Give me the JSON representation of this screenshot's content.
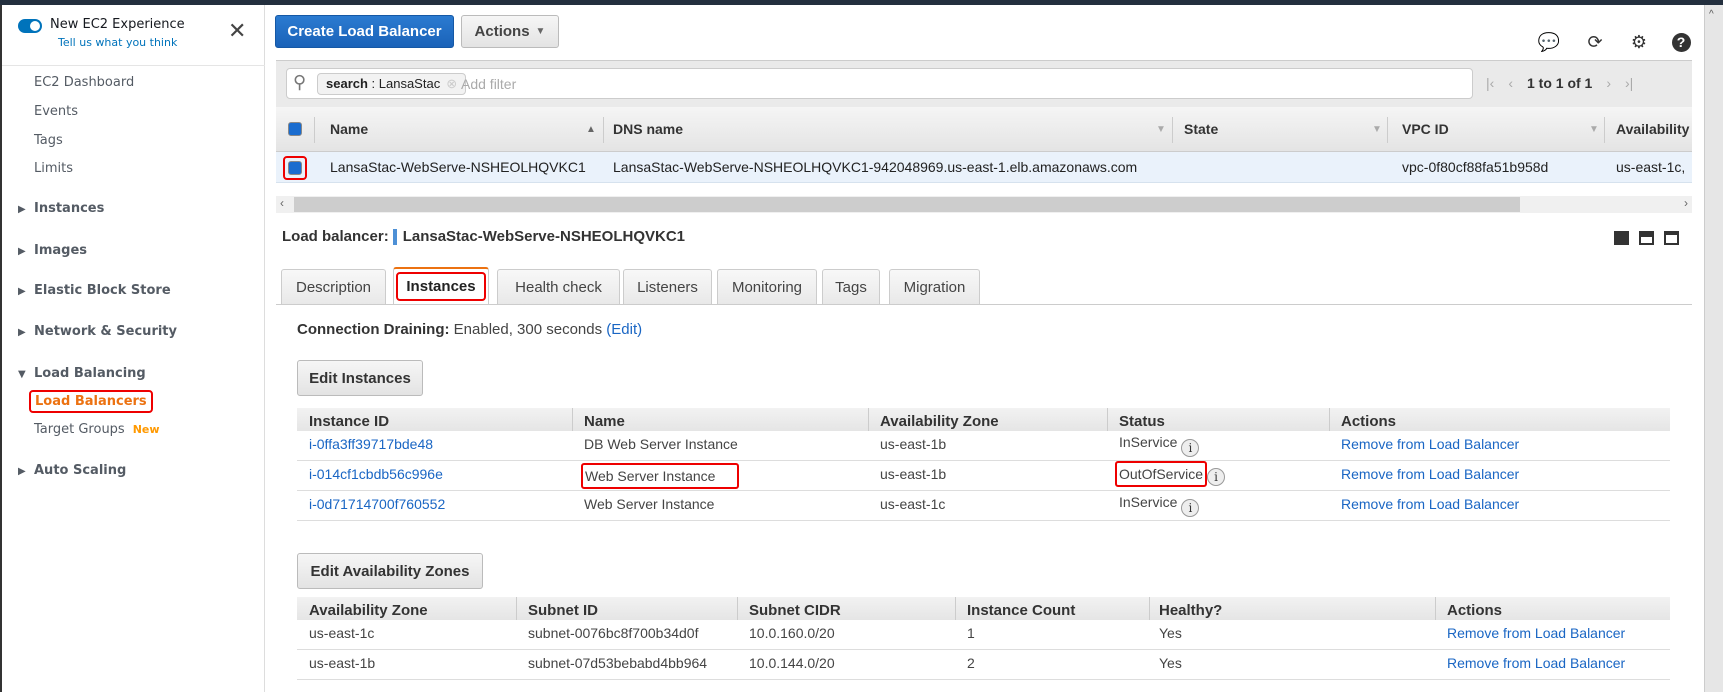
{
  "sidebar": {
    "experience_title": "New EC2 Experience",
    "feedback_link": "Tell us what you think",
    "items": [
      "EC2 Dashboard",
      "Events",
      "Tags",
      "Limits"
    ],
    "sections": [
      "Instances",
      "Images",
      "Elastic Block Store",
      "Network & Security",
      "Load Balancing",
      "Auto Scaling"
    ],
    "load_balancing_items": {
      "active": "Load Balancers",
      "target_groups": "Target Groups",
      "new_badge": "New"
    }
  },
  "toolbar": {
    "create_label": "Create Load Balancer",
    "actions_label": "Actions"
  },
  "filter": {
    "chip_key": "search",
    "chip_value": " : LansaStac",
    "placeholder": "Add filter",
    "pagination": "1 to 1 of 1"
  },
  "lb_table": {
    "headers": [
      "Name",
      "DNS name",
      "State",
      "VPC ID",
      "Availability"
    ],
    "row": {
      "name": "LansaStac-WebServe-NSHEOLHQVKC1",
      "dns": "LansaStac-WebServe-NSHEOLHQVKC1-942048969.us-east-1.elb.amazonaws.com",
      "state": "",
      "vpc": "vpc-0f80cf88fa51b958d",
      "az": "us-east-1c,"
    }
  },
  "details": {
    "label": "Load balancer:",
    "name": "LansaStac-WebServe-NSHEOLHQVKC1",
    "tabs": [
      "Description",
      "Instances",
      "Health check",
      "Listeners",
      "Monitoring",
      "Tags",
      "Migration"
    ],
    "connection_draining_label": "Connection Draining:",
    "connection_draining_value": "Enabled, 300 seconds",
    "edit_link": "(Edit)",
    "edit_instances": "Edit Instances",
    "instances_headers": [
      "Instance ID",
      "Name",
      "Availability Zone",
      "Status",
      "Actions"
    ],
    "instances": [
      {
        "id": "i-0ffa3ff39717bde48",
        "name": "DB Web Server Instance",
        "az": "us-east-1b",
        "status": "InService",
        "action": "Remove from Load Balancer"
      },
      {
        "id": "i-014cf1cbdb56c996e",
        "name": "Web Server Instance",
        "az": "us-east-1b",
        "status": "OutOfService",
        "action": "Remove from Load Balancer"
      },
      {
        "id": "i-0d71714700f760552",
        "name": "Web Server Instance",
        "az": "us-east-1c",
        "status": "InService",
        "action": "Remove from Load Balancer"
      }
    ],
    "edit_azs": "Edit Availability Zones",
    "az_headers": [
      "Availability Zone",
      "Subnet ID",
      "Subnet CIDR",
      "Instance Count",
      "Healthy?",
      "Actions"
    ],
    "azs": [
      {
        "zone": "us-east-1c",
        "subnet": "subnet-0076bc8f700b34d0f",
        "cidr": "10.0.160.0/20",
        "count": "1",
        "healthy": "Yes",
        "action": "Remove from Load Balancer"
      },
      {
        "zone": "us-east-1b",
        "subnet": "subnet-07d53bebabd4bb964",
        "cidr": "10.0.144.0/20",
        "count": "2",
        "healthy": "Yes",
        "action": "Remove from Load Balancer"
      }
    ]
  },
  "colors": {
    "primary": "#1a62b8",
    "link": "#1a66c4",
    "active_nav": "#ec7211",
    "highlight": "#e00000"
  }
}
